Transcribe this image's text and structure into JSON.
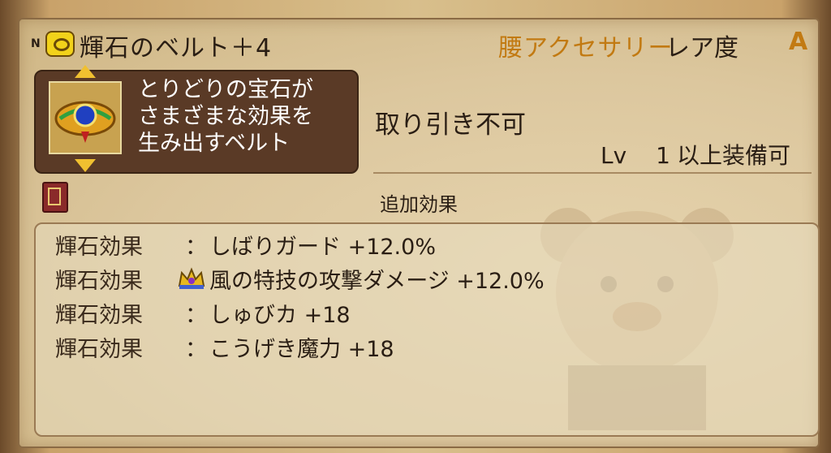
{
  "item": {
    "badge": "N",
    "name": "輝石のベルト＋4",
    "category": "腰アクセサリー",
    "rarity_label": "レア度",
    "rarity_value": "A",
    "description": "とりどりの宝石が\nさまざまな効果を\n生み出すベルト",
    "trade": "取り引き不可",
    "level_label": "Lv",
    "level_value": "1",
    "level_suffix": "以上装備可"
  },
  "bonus": {
    "heading": "追加効果",
    "effects": [
      {
        "label": "輝石効果",
        "sep": "：",
        "text": "しばりガード +12.0%",
        "icon": ""
      },
      {
        "label": "輝石効果",
        "sep": "",
        "text": "風の特技の攻撃ダメージ +12.0%",
        "icon": "crown-icon"
      },
      {
        "label": "輝石効果",
        "sep": "：",
        "text": "しゅびカ +18",
        "icon": ""
      },
      {
        "label": "輝石効果",
        "sep": "：",
        "text": "こうげき魔力 +18",
        "icon": ""
      }
    ]
  },
  "colors": {
    "accent": "#c27a12",
    "text": "#2a1e14",
    "desc_bg": "#5a3a26"
  }
}
